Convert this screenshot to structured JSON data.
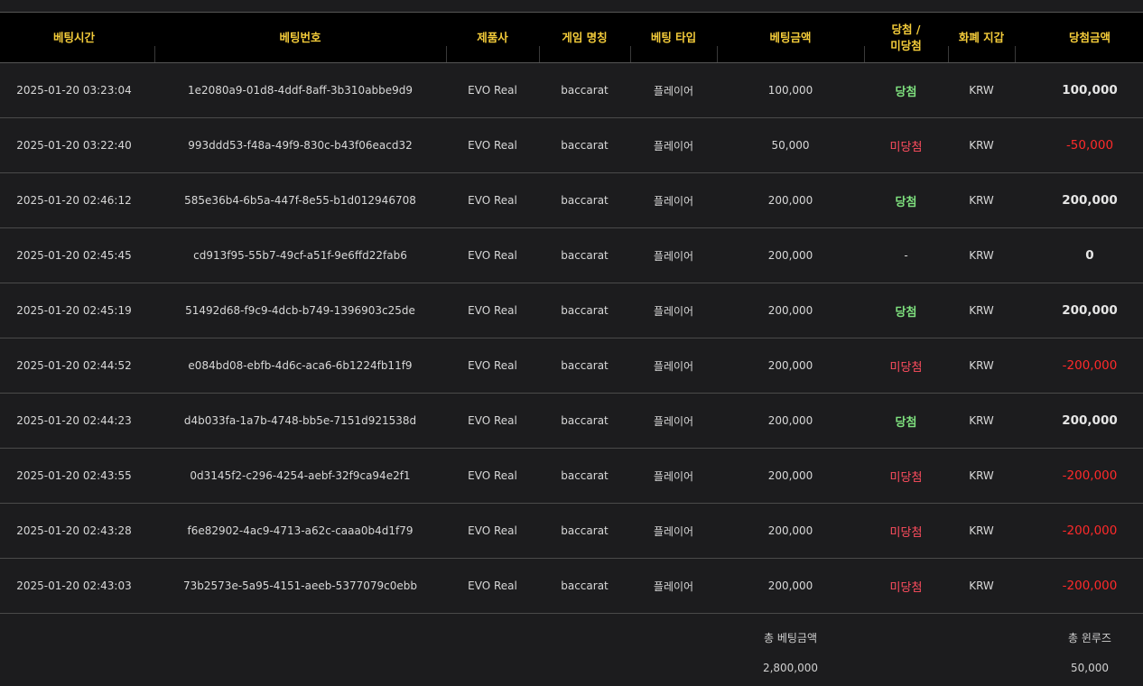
{
  "columns": {
    "time": "베팅시간",
    "bet_id": "베팅번호",
    "provider": "제품사",
    "game": "게임 명칭",
    "bet_type": "베팅 타입",
    "bet_amount": "베팅금액",
    "result_line1": "당첨 /",
    "result_line2": "미당첨",
    "currency": "화폐 지갑",
    "win_amount": "당첨금액"
  },
  "rows": [
    {
      "time": "2025-01-20 03:23:04",
      "bet_id": "1e2080a9-01d8-4ddf-8aff-3b310abbe9d9",
      "provider": "EVO Real",
      "game": "baccarat",
      "bet_type": "플레이어",
      "bet_amount": "100,000",
      "result": "당첨",
      "currency": "KRW",
      "win_amount": "100,000"
    },
    {
      "time": "2025-01-20 03:22:40",
      "bet_id": "993ddd53-f48a-49f9-830c-b43f06eacd32",
      "provider": "EVO Real",
      "game": "baccarat",
      "bet_type": "플레이어",
      "bet_amount": "50,000",
      "result": "미당첨",
      "currency": "KRW",
      "win_amount": "-50,000"
    },
    {
      "time": "2025-01-20 02:46:12",
      "bet_id": "585e36b4-6b5a-447f-8e55-b1d012946708",
      "provider": "EVO Real",
      "game": "baccarat",
      "bet_type": "플레이어",
      "bet_amount": "200,000",
      "result": "당첨",
      "currency": "KRW",
      "win_amount": "200,000"
    },
    {
      "time": "2025-01-20 02:45:45",
      "bet_id": "cd913f95-55b7-49cf-a51f-9e6ffd22fab6",
      "provider": "EVO Real",
      "game": "baccarat",
      "bet_type": "플레이어",
      "bet_amount": "200,000",
      "result": "-",
      "currency": "KRW",
      "win_amount": "0"
    },
    {
      "time": "2025-01-20 02:45:19",
      "bet_id": "51492d68-f9c9-4dcb-b749-1396903c25de",
      "provider": "EVO Real",
      "game": "baccarat",
      "bet_type": "플레이어",
      "bet_amount": "200,000",
      "result": "당첨",
      "currency": "KRW",
      "win_amount": "200,000"
    },
    {
      "time": "2025-01-20 02:44:52",
      "bet_id": "e084bd08-ebfb-4d6c-aca6-6b1224fb11f9",
      "provider": "EVO Real",
      "game": "baccarat",
      "bet_type": "플레이어",
      "bet_amount": "200,000",
      "result": "미당첨",
      "currency": "KRW",
      "win_amount": "-200,000"
    },
    {
      "time": "2025-01-20 02:44:23",
      "bet_id": "d4b033fa-1a7b-4748-bb5e-7151d921538d",
      "provider": "EVO Real",
      "game": "baccarat",
      "bet_type": "플레이어",
      "bet_amount": "200,000",
      "result": "당첨",
      "currency": "KRW",
      "win_amount": "200,000"
    },
    {
      "time": "2025-01-20 02:43:55",
      "bet_id": "0d3145f2-c296-4254-aebf-32f9ca94e2f1",
      "provider": "EVO Real",
      "game": "baccarat",
      "bet_type": "플레이어",
      "bet_amount": "200,000",
      "result": "미당첨",
      "currency": "KRW",
      "win_amount": "-200,000"
    },
    {
      "time": "2025-01-20 02:43:28",
      "bet_id": "f6e82902-4ac9-4713-a62c-caaa0b4d1f79",
      "provider": "EVO Real",
      "game": "baccarat",
      "bet_type": "플레이어",
      "bet_amount": "200,000",
      "result": "미당첨",
      "currency": "KRW",
      "win_amount": "-200,000"
    },
    {
      "time": "2025-01-20 02:43:03",
      "bet_id": "73b2573e-5a95-4151-aeeb-5377079c0ebb",
      "provider": "EVO Real",
      "game": "baccarat",
      "bet_type": "플레이어",
      "bet_amount": "200,000",
      "result": "미당첨",
      "currency": "KRW",
      "win_amount": "-200,000"
    }
  ],
  "footer": {
    "total_bet_label": "총 베팅금액",
    "total_bet_value": "2,800,000",
    "total_winloss_label": "총 윈루즈",
    "total_winloss_value": "50,000"
  },
  "colors": {
    "header_text": "#f4cc3a",
    "win": "#7ee07e",
    "lose": "#ff4d5e",
    "negative_amount": "#ff2a2a"
  }
}
